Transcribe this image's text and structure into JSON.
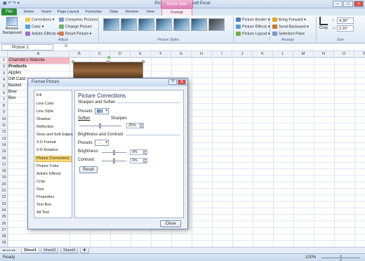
{
  "window": {
    "title": "Picture This! - Microsoft Excel",
    "context_tab": "Picture Tools"
  },
  "tabs": [
    "Home",
    "Insert",
    "Page Layout",
    "Formulas",
    "Data",
    "Review",
    "View",
    "Format"
  ],
  "file_tab": "File",
  "ribbon": {
    "remove_background": "Remove Background",
    "corrections": "Corrections",
    "color": "Color",
    "artistic_effects": "Artistic Effects",
    "compress_pictures": "Compress Pictures",
    "change_picture": "Change Picture",
    "reset_picture": "Reset Picture",
    "adjust_label": "Adjust",
    "picture_styles_label": "Picture Styles",
    "picture_border": "Picture Border",
    "picture_effects": "Picture Effects",
    "picture_layout": "Picture Layout",
    "bring_forward": "Bring Forward",
    "send_backward": "Send Backward",
    "selection_pane": "Selection Pane",
    "arrange_label": "Arrange",
    "crop": "Crop",
    "height": "4.38\"",
    "width": "2.29\"",
    "size_label": "Size"
  },
  "formula_bar": {
    "name_box": "Picture 1",
    "fx": "fx"
  },
  "columns": [
    "A",
    "B",
    "C",
    "D",
    "E",
    "F",
    "G",
    "H",
    "I",
    "J",
    "K",
    "L",
    "M",
    "N",
    "O",
    "P"
  ],
  "rows": [
    "1",
    "2",
    "3",
    "4",
    "5",
    "6",
    "7",
    "8",
    "9",
    "10",
    "11",
    "12",
    "13",
    "14",
    "15",
    "16",
    "17",
    "18",
    "19",
    "20",
    "21",
    "22",
    "23",
    "24",
    "25",
    "26",
    "27",
    "28",
    "29"
  ],
  "cells": [
    "Charlotte's Website",
    "Products",
    "Apples",
    "Gift Card",
    "Basket",
    "Bow",
    "Box"
  ],
  "dialog": {
    "title": "Format Picture",
    "help": "?",
    "close_x": "X",
    "categories": [
      "Fill",
      "Line Color",
      "Line Style",
      "Shadow",
      "Reflection",
      "Glow and Soft Edges",
      "3-D Format",
      "3-D Rotation",
      "Picture Corrections",
      "Picture Color",
      "Artistic Effects",
      "Crop",
      "Size",
      "Properties",
      "Text Box",
      "Alt Text"
    ],
    "selected_category": "Picture Corrections",
    "panel_title": "Picture Corrections",
    "sharpen_section": "Sharpen and Soften",
    "presets_label": "Presets:",
    "soften_label": "Soften",
    "sharpen_label": "Sharpen",
    "sharpen_value": "25%",
    "sharpen_level": 0.5,
    "brightness_section": "Brightness and Contrast",
    "brightness_label": "Brightness:",
    "brightness_value": "0%",
    "contrast_label": "Contrast:",
    "contrast_value": "0%",
    "reset_label": "Reset",
    "close_label": "Close"
  },
  "sheets": [
    "Sheet1",
    "Sheet2",
    "Sheet3"
  ],
  "status": {
    "ready": "Ready",
    "zoom": "100%"
  }
}
